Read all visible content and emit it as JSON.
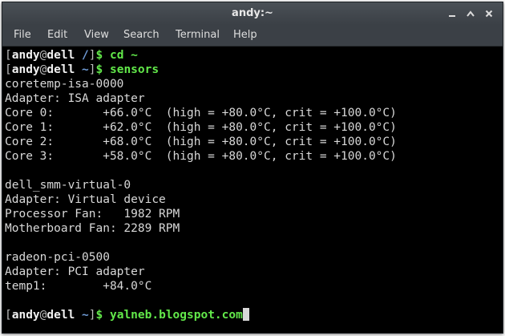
{
  "window": {
    "title": "andy:~",
    "controls": {
      "minimize": "minimize-icon",
      "maximize": "maximize-icon",
      "close": "close-icon"
    }
  },
  "menu": [
    "File",
    "Edit",
    "View",
    "Search",
    "Terminal",
    "Help"
  ],
  "prompt": {
    "open": "[",
    "user": "andy",
    "at": "@",
    "host": "dell",
    "close": "]",
    "symbol": "$"
  },
  "commands": [
    {
      "dir": "/",
      "cmd": "cd ~"
    },
    {
      "dir": "~",
      "cmd": "sensors"
    }
  ],
  "output": [
    "coretemp-isa-0000",
    "Adapter: ISA adapter",
    "Core 0:       +66.0°C  (high = +80.0°C, crit = +100.0°C)",
    "Core 1:       +62.0°C  (high = +80.0°C, crit = +100.0°C)",
    "Core 2:       +68.0°C  (high = +80.0°C, crit = +100.0°C)",
    "Core 3:       +58.0°C  (high = +80.0°C, crit = +100.0°C)",
    "",
    "dell_smm-virtual-0",
    "Adapter: Virtual device",
    "Processor Fan:   1982 RPM",
    "Motherboard Fan: 2289 RPM",
    "",
    "radeon-pci-0500",
    "Adapter: PCI adapter",
    "temp1:        +84.0°C",
    ""
  ],
  "current": {
    "dir": "~",
    "input": "yalneb.blogspot.com"
  },
  "colors": {
    "green": "#62e84a",
    "blue": "#6f9bd6",
    "text": "#d8d8d8",
    "titlebar": "#3b4046"
  }
}
